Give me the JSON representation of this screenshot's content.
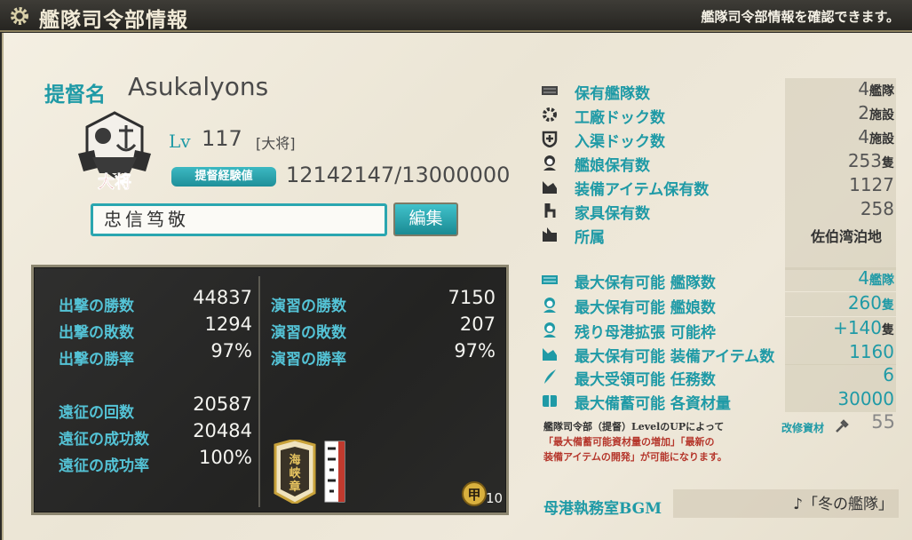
{
  "header": {
    "title": "艦隊司令部情報",
    "subtitle": "艦隊司令部情報を確認できます。"
  },
  "admiral": {
    "name_label": "提督名",
    "name": "Asukalyons",
    "lv_label": "Lv",
    "level": "117",
    "rank": "[大将]",
    "emblem_text": "大将",
    "exp_label": "提督経験値",
    "exp_value": "12142147/13000000",
    "comment": "忠信笃敬",
    "edit_label": "編集"
  },
  "battle": {
    "left": [
      {
        "label": "出撃の勝数",
        "value": "44837"
      },
      {
        "label": "出撃の敗数",
        "value": "1294"
      },
      {
        "label": "出撃の勝率",
        "value": "97%"
      },
      {
        "label": "遠征の回数",
        "value": "20587"
      },
      {
        "label": "遠征の成功数",
        "value": "20484"
      },
      {
        "label": "遠征の成功率",
        "value": "100%"
      }
    ],
    "right": [
      {
        "label": "演習の勝数",
        "value": "7150"
      },
      {
        "label": "演習の敗数",
        "value": "207"
      },
      {
        "label": "演習の勝率",
        "value": "97%"
      }
    ],
    "medal_text": "海峡章",
    "kou_label": "甲",
    "kou_count": "10"
  },
  "info": [
    {
      "icon": "fleet-icon",
      "label": "保有艦隊数",
      "value": "4",
      "unit": "艦隊"
    },
    {
      "icon": "gear-icon",
      "label": "工廠ドック数",
      "value": "2",
      "unit": "施設"
    },
    {
      "icon": "repair-icon",
      "label": "入渠ドック数",
      "value": "4",
      "unit": "施設"
    },
    {
      "icon": "shipgirl-icon",
      "label": "艦娘保有数",
      "value": "253",
      "unit": "隻"
    },
    {
      "icon": "equipment-icon",
      "label": "装備アイテム保有数",
      "value": "1127",
      "unit": ""
    },
    {
      "icon": "chair-icon",
      "label": "家具保有数",
      "value": "258",
      "unit": ""
    },
    {
      "icon": "port-icon",
      "label": "所属",
      "value": "佐伯湾泊地",
      "unit": ""
    }
  ],
  "limits": [
    {
      "icon": "fleet-icon",
      "label": "最大保有可能 艦隊数",
      "value": "4",
      "unit": "艦隊"
    },
    {
      "icon": "shipgirl-icon",
      "label": "最大保有可能 艦娘数",
      "value": "260",
      "unit": "隻"
    },
    {
      "icon": "shipgirl-icon",
      "label": "残り母港拡張 可能枠",
      "value": "+140",
      "unit": "隻"
    },
    {
      "icon": "equipment-icon",
      "label": "最大保有可能 装備アイテム数",
      "value": "1160",
      "unit": ""
    },
    {
      "icon": "quest-icon",
      "label": "最大受領可能 任務数",
      "value": "6",
      "unit": ""
    },
    {
      "icon": "resource-icon",
      "label": "最大備蓄可能 各資材量",
      "value": "30000",
      "unit": ""
    }
  ],
  "note": {
    "line1": "艦隊司令部（提督）LevelのUPによって",
    "line2": "「最大備蓄可能資材量の増加」「最新の",
    "line3": "装備アイテムの開発」が可能になります。"
  },
  "improvement": {
    "label": "改修資材",
    "value": "55"
  },
  "bgm": {
    "label": "母港執務室BGM",
    "value": "♪「冬の艦隊」"
  },
  "colors": {
    "accent": "#1f9aa6",
    "board": "#2a2a28",
    "parchment": "#efe9db"
  }
}
